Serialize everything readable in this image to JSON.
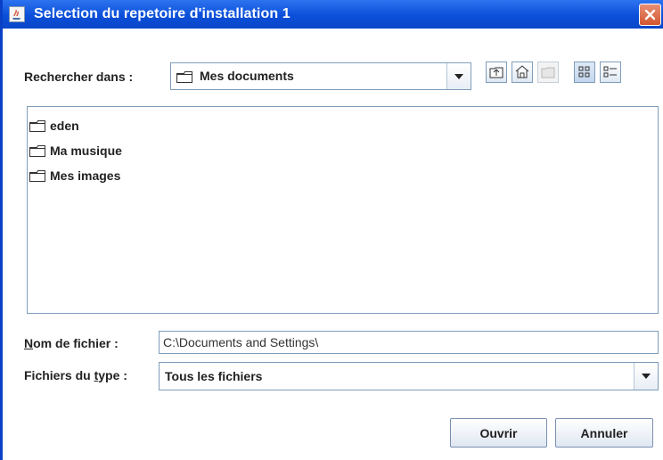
{
  "window": {
    "title": "Selection du repetoire d'installation 1"
  },
  "lookin": {
    "label": "Rechercher dans :",
    "value": "Mes documents"
  },
  "toolbar": {
    "up_icon": "folder-up-icon",
    "home_icon": "home-icon",
    "new_folder_icon": "new-folder-icon",
    "list_view_icon": "list-view-icon",
    "details_view_icon": "details-view-icon"
  },
  "files": [
    {
      "name": "eden",
      "icon": "folder-icon"
    },
    {
      "name": "Ma musique",
      "icon": "folder-icon"
    },
    {
      "name": "Mes images",
      "icon": "folder-icon"
    }
  ],
  "filename": {
    "label_prefix": "N",
    "label_rest": "om de fichier :",
    "value": "C:\\Documents and Settings\\"
  },
  "filetype": {
    "label_prefix": "Fichiers du ",
    "label_underline": "t",
    "label_rest": "ype :",
    "value": "Tous les fichiers"
  },
  "buttons": {
    "open": "Ouvrir",
    "cancel": "Annuler"
  },
  "colors": {
    "title_bar": "#0b4fd9",
    "close_button": "#d2562f",
    "border": "#7f9db9"
  }
}
